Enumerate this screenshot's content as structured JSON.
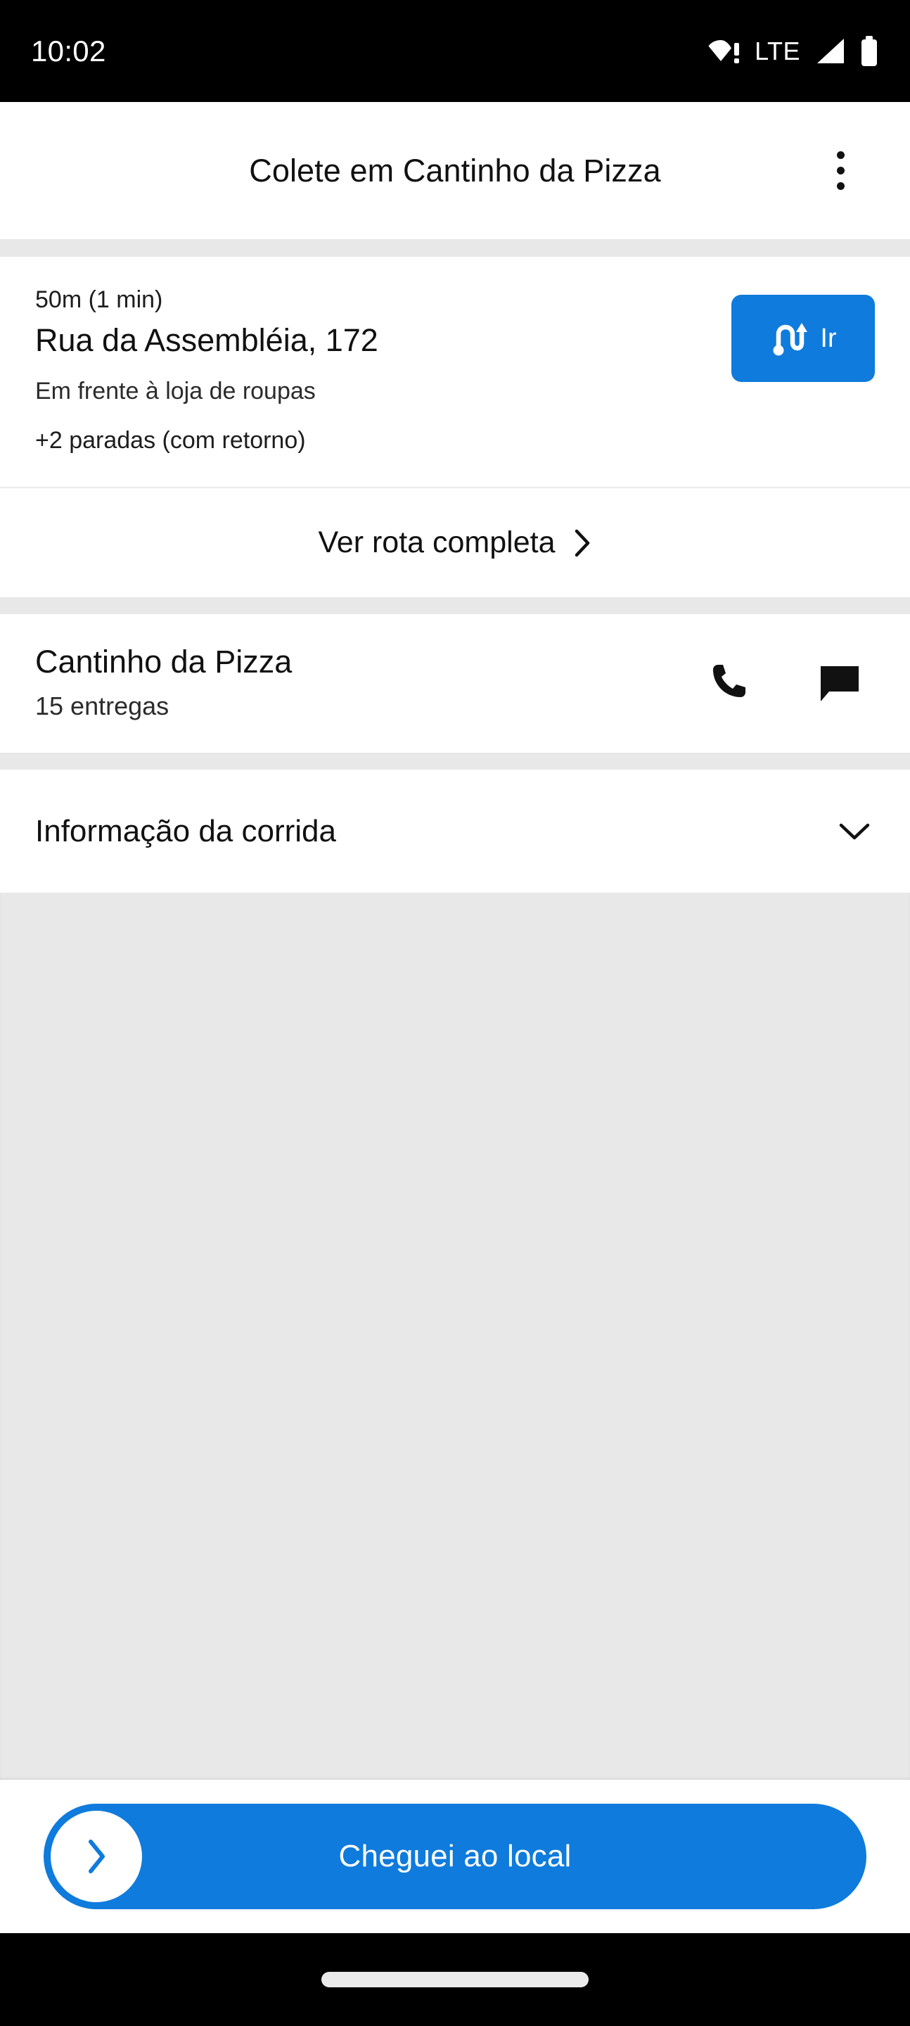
{
  "status_bar": {
    "time": "10:02",
    "network_label": "LTE",
    "icons": [
      "wifi-warning-icon",
      "signal-icon",
      "battery-icon"
    ]
  },
  "header": {
    "title": "Colete em Cantinho da Pizza",
    "overflow_icon": "more-vert-icon"
  },
  "address_card": {
    "eta": "50m (1 min)",
    "street": "Rua da Assembléia, 172",
    "reference": "Em frente à loja de roupas",
    "stops": "+2 paradas (com retorno)",
    "go_button": {
      "label": "Ir",
      "icon": "route-icon"
    }
  },
  "route_row": {
    "label": "Ver rota completa",
    "chevron_icon": "chevron-right-icon"
  },
  "merchant": {
    "name": "Cantinho da Pizza",
    "deliveries": "15 entregas",
    "call_icon": "phone-icon",
    "message_icon": "chat-bubble-icon"
  },
  "trip_info": {
    "label": "Informação da corrida",
    "chevron_icon": "chevron-down-icon",
    "expanded": false
  },
  "footer": {
    "cta_label": "Cheguei ao local",
    "thumb_icon": "chevron-right-icon"
  },
  "theme": {
    "accent": "#0f7bdc",
    "surface": "#ffffff",
    "divider": "#e8e8e8",
    "text_primary": "#111111",
    "status_bar_bg": "#000000"
  }
}
